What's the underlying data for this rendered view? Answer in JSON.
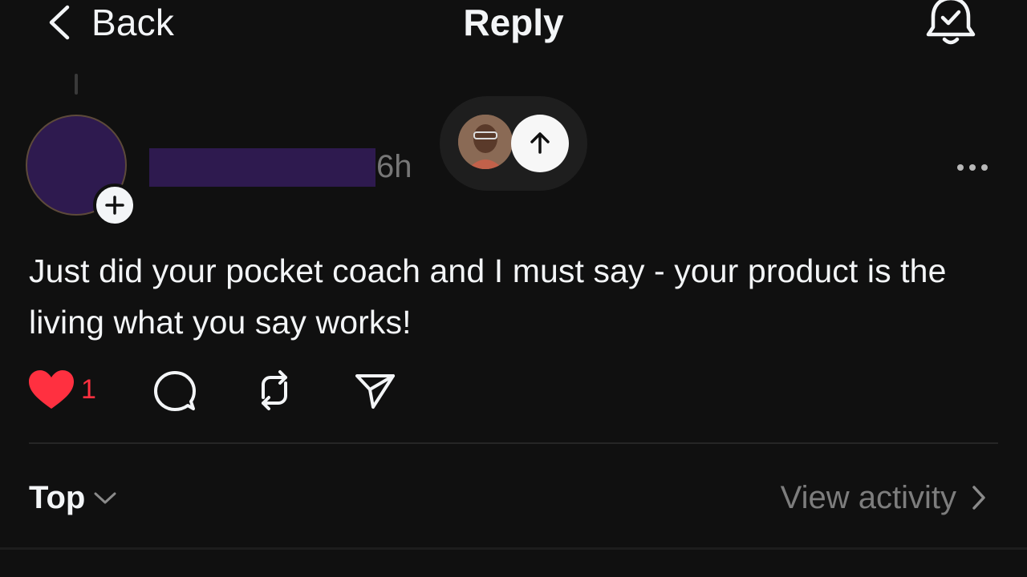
{
  "header": {
    "back_label": "Back",
    "title": "Reply",
    "notify_icon": "bell-check-icon"
  },
  "post": {
    "timestamp": "6h",
    "text": "Just did your pocket coach and I must say - your product is the living what you say works!",
    "like_count": "1",
    "liked": true,
    "colors": {
      "like": "#ff3040",
      "redaction": "#2e1a4f",
      "background": "#101010"
    }
  },
  "replies_bar": {
    "sort_label": "Top",
    "activity_label": "View activity"
  }
}
